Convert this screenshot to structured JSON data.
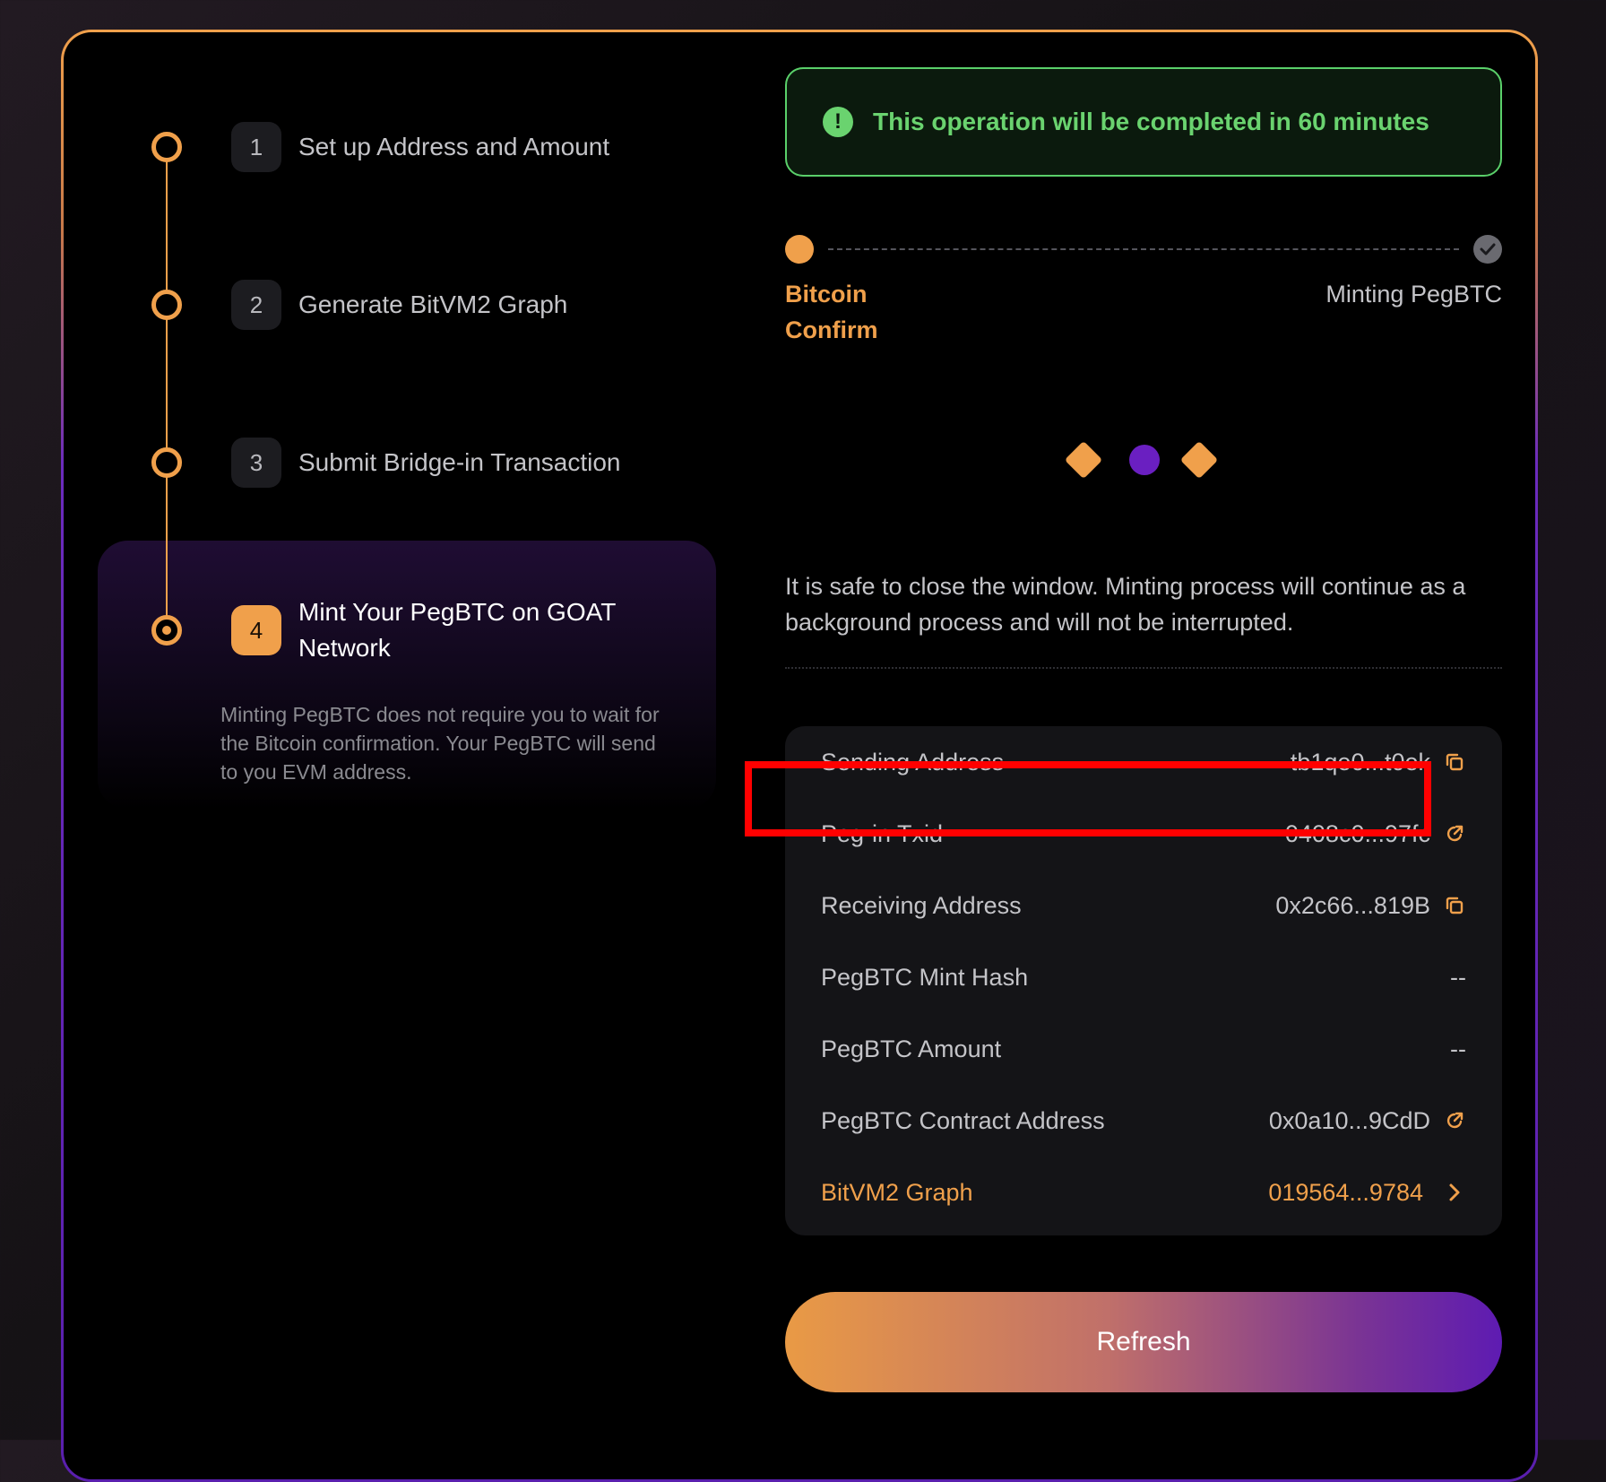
{
  "steps": [
    {
      "number": "1",
      "label": "Set up Address and Amount"
    },
    {
      "number": "2",
      "label": "Generate BitVM2 Graph"
    },
    {
      "number": "3",
      "label": "Submit Bridge-in Transaction"
    },
    {
      "number": "4",
      "label": "Mint Your PegBTC on GOAT Network"
    }
  ],
  "active_step_description": "Minting PegBTC does not require you to wait for the Bitcoin confirmation. Your PegBTC will send to you EVM address.",
  "notice": {
    "icon": "exclamation-icon",
    "text": "This operation will be completed in 60 minutes",
    "color": "#6ad36f"
  },
  "progress": {
    "left_label": "Bitcoin Confirm",
    "right_label": "Minting PegBTC",
    "right_icon": "check-icon"
  },
  "safe_message": "It is safe to close the window. Minting process will continue as a background process and will not be interrupted.",
  "details": [
    {
      "label": "Sending Address",
      "value": "tb1qe0...t0ek",
      "icon": "copy-icon"
    },
    {
      "label": "Peg-in Txid",
      "value": "0408c0...97fc",
      "icon": "external-link-icon"
    },
    {
      "label": "Receiving Address",
      "value": "0x2c66...819B",
      "icon": "copy-icon"
    },
    {
      "label": "PegBTC Mint Hash",
      "value": "--",
      "icon": ""
    },
    {
      "label": "PegBTC Amount",
      "value": "--",
      "icon": ""
    },
    {
      "label": "PegBTC Contract Address",
      "value": "0x0a10...9CdD",
      "icon": "external-link-icon"
    },
    {
      "label": "BitVM2 Graph",
      "value": "019564...9784",
      "icon": "chevron-right-icon"
    }
  ],
  "refresh_label": "Refresh",
  "colors": {
    "accent": "#f0a04b",
    "purple": "#6a1fc1",
    "success": "#6ad36f",
    "highlight": "#ff0000"
  }
}
